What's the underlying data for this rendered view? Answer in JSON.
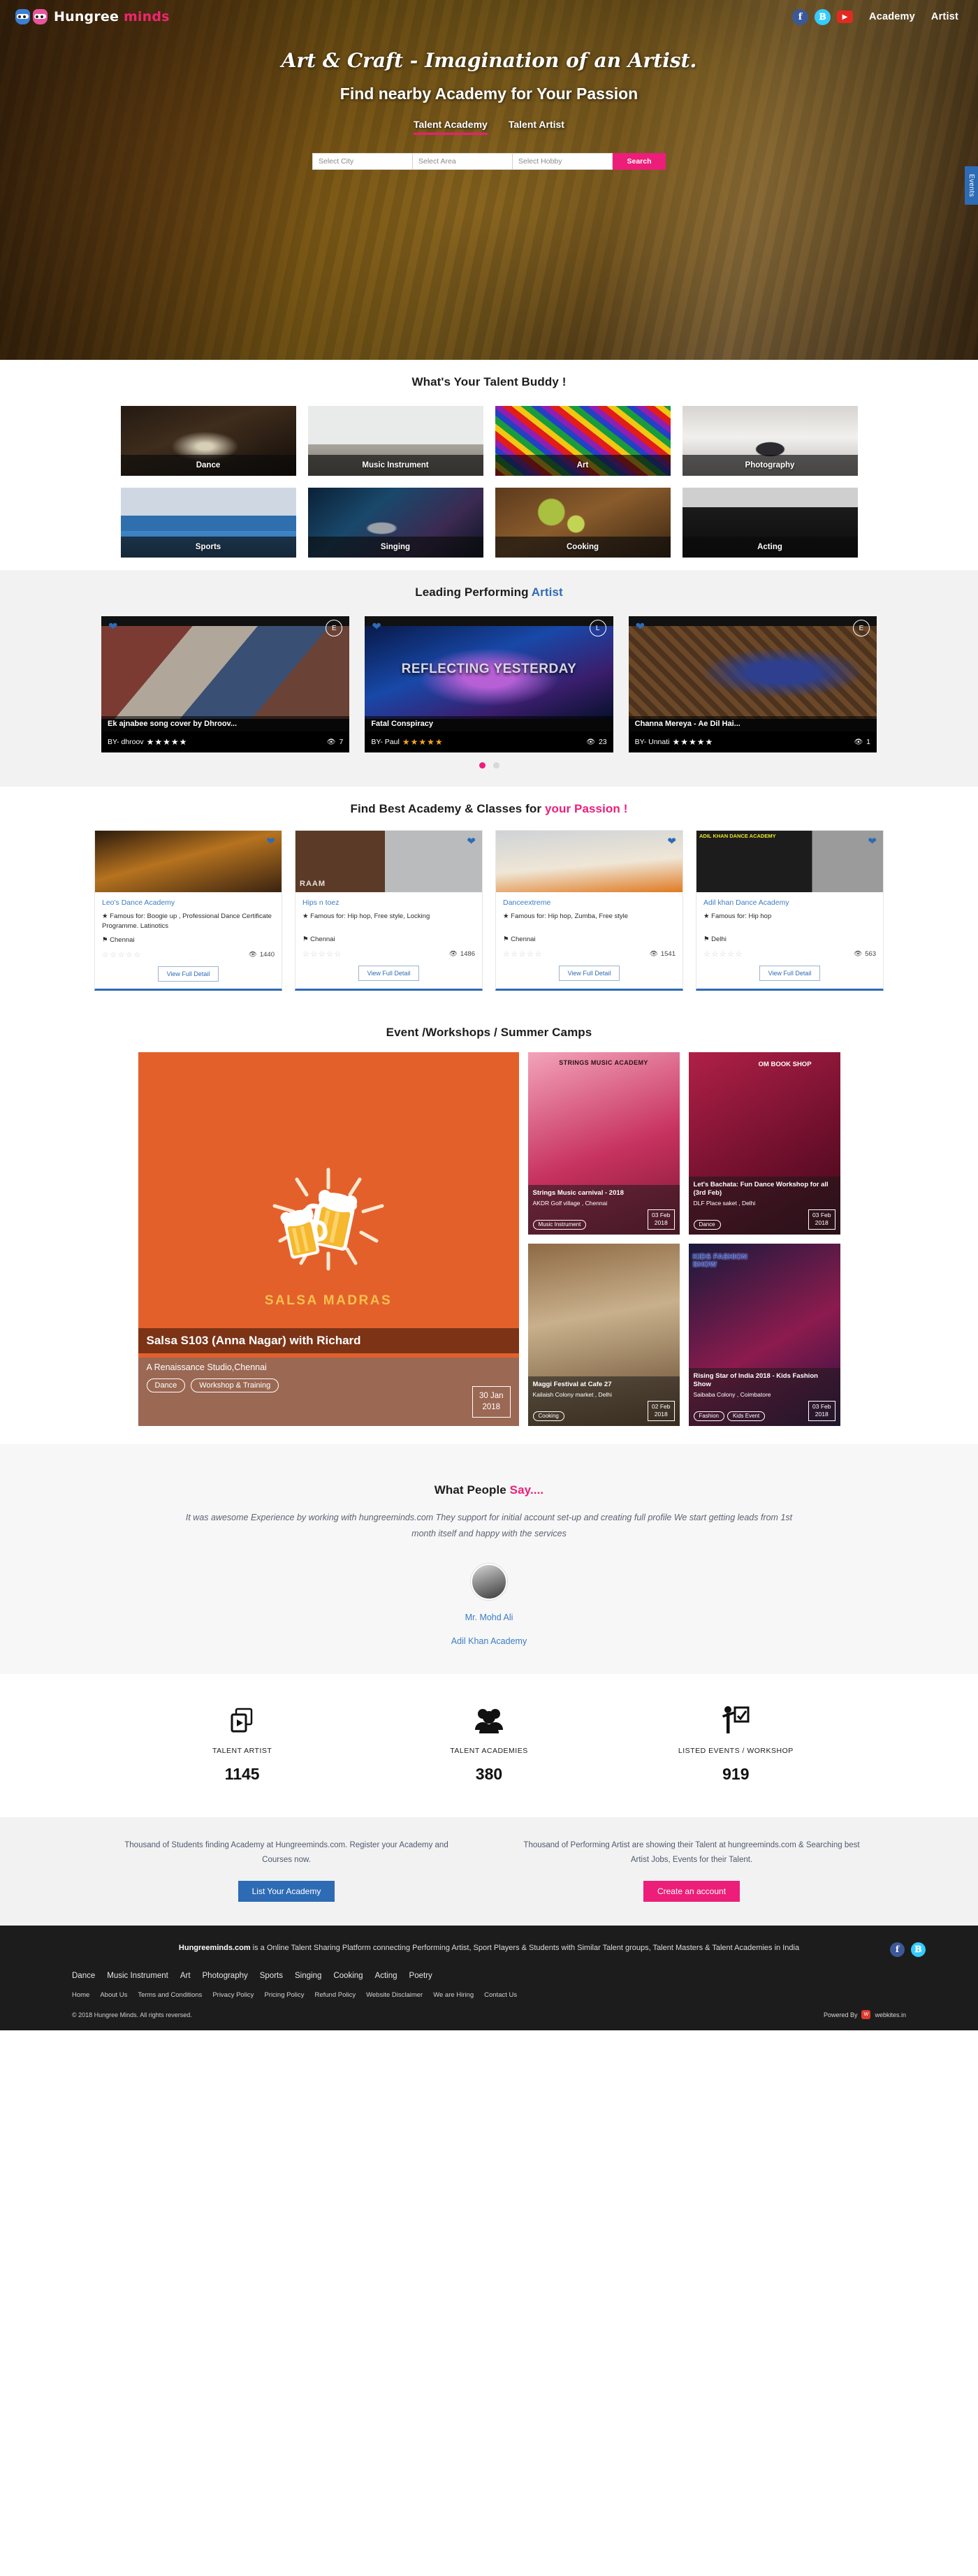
{
  "header": {
    "logo_text_main": "Hungree",
    "logo_text_accent": "minds",
    "social": [
      {
        "name": "facebook-icon",
        "glyph": "f"
      },
      {
        "name": "twitter-icon",
        "glyph": "t"
      },
      {
        "name": "youtube-icon",
        "glyph": "▶"
      }
    ],
    "nav": [
      "Academy",
      "Artist"
    ]
  },
  "hero": {
    "title": "Art & Craft - Imagination of an Artist.",
    "subtitle": "Find nearby Academy for Your Passion",
    "tabs": [
      {
        "label": "Talent Academy",
        "active": true
      },
      {
        "label": "Talent Artist",
        "active": false
      }
    ],
    "search": {
      "city_placeholder": "Select City",
      "area_placeholder": "Select Area",
      "hobby_placeholder": "Select Hobby",
      "button_label": "Search"
    },
    "events_tab_label": "Events"
  },
  "talent": {
    "title": "What's Your Talent Buddy !",
    "items": [
      {
        "label": "Dance",
        "bg": "bg-dance"
      },
      {
        "label": "Music Instrument",
        "bg": "bg-music"
      },
      {
        "label": "Art",
        "bg": "bg-art"
      },
      {
        "label": "Photography",
        "bg": "bg-photo"
      },
      {
        "label": "Sports",
        "bg": "bg-sports"
      },
      {
        "label": "Singing",
        "bg": "bg-singing"
      },
      {
        "label": "Cooking",
        "bg": "bg-cooking"
      },
      {
        "label": "Acting",
        "bg": "bg-acting"
      }
    ]
  },
  "artists": {
    "title_plain": "Leading Performing ",
    "title_accent": "Artist",
    "cards": [
      {
        "title": "Ek ajnabee song cover by Dhroov...",
        "by": "BY- dhroov",
        "badge": "E",
        "stars": "★★★★★",
        "star_color": "white",
        "views": "7"
      },
      {
        "title": "Fatal Conspiracy",
        "by": "BY- Paul",
        "badge": "L",
        "stars": "★★★★★",
        "star_color": "gold",
        "views": "23",
        "overlay_text": "REFLECTING YESTERDAY"
      },
      {
        "title": "Channa Mereya - Ae Dil Hai...",
        "by": "BY- Unnati",
        "badge": "E",
        "stars": "★★★★★",
        "star_color": "white",
        "views": "1"
      }
    ],
    "dots": [
      true,
      false
    ]
  },
  "academies": {
    "title_plain": "Find Best Academy & Classes for ",
    "title_accent": "your Passion !",
    "empty_stars": "☆☆☆☆☆",
    "view_label": "View Full Detail",
    "cards": [
      {
        "name": "Leo's Dance Academy",
        "famous": "★ Famous for: Boogie up , Professional Dance Certificate Programme. Latinotics",
        "location": "⚑ Chennai",
        "views": "1440",
        "thumb": "t1"
      },
      {
        "name": "Hips n toez",
        "famous": "★ Famous for: Hip hop, Free style, Locking",
        "location": "⚑ Chennai",
        "views": "1486",
        "thumb": "t2"
      },
      {
        "name": "Danceextreme",
        "famous": "★ Famous for: Hip hop, Zumba, Free style",
        "location": "⚑ Chennai",
        "views": "1541",
        "thumb": "t3"
      },
      {
        "name": "Adil khan Dance Academy",
        "famous": "★ Famous for: Hip hop",
        "location": "⚑ Delhi",
        "views": "563",
        "thumb": "t4"
      }
    ]
  },
  "events": {
    "title": "Event /Workshops / Summer Camps",
    "featured": {
      "poster_brand": "SALSA MADRAS",
      "title": "Salsa S103 (Anna Nagar) with Richard",
      "place": "A Renaissance Studio,Chennai",
      "tags": [
        "Dance",
        "Workshop & Training"
      ],
      "date_day": "30 Jan",
      "date_year": "2018"
    },
    "small": [
      {
        "title": "Strings Music carnival - 2018",
        "place": "AKDR Golf village ,  Chennai",
        "tags": [
          "Music Instrument"
        ],
        "date_day": "03 Feb",
        "date_year": "2018",
        "bg": "s1"
      },
      {
        "title": "Let's Bachata: Fun Dance Workshop for all (3rd Feb)",
        "place": "DLF Place saket ,  Delhi",
        "tags": [
          "Dance"
        ],
        "date_day": "03 Feb",
        "date_year": "2018",
        "bg": "s2"
      },
      {
        "title": "Maggi Festival at Cafe 27",
        "place": "Kailaish Colony market ,  Delhi",
        "tags": [
          "Cooking"
        ],
        "date_day": "02 Feb",
        "date_year": "2018",
        "bg": "s3"
      },
      {
        "title": "Rising Star of India 2018 - Kids Fashion Show",
        "place": "Saibaba Colony , Coimbatore",
        "tags": [
          "Fashion",
          "Kids Event"
        ],
        "date_day": "03 Feb",
        "date_year": "2018",
        "bg": "s4"
      }
    ]
  },
  "testimonial": {
    "title_plain": "What People ",
    "title_accent": "Say....",
    "quote": "It was awesome Experience by working with hungreeminds.com They support for initial account set-up and creating full profile We start getting leads from 1st month itself and happy with the services",
    "name": "Mr. Mohd Ali",
    "org": "Adil Khan Academy"
  },
  "stats": [
    {
      "icon": "video-player-icon",
      "label": "TALENT ARTIST",
      "value": "1145"
    },
    {
      "icon": "users-group-icon",
      "label": "TALENT ACADEMIES",
      "value": "380"
    },
    {
      "icon": "presenter-board-icon",
      "label": "LISTED EVENTS / WORKSHOP",
      "value": "919"
    }
  ],
  "cta": {
    "left": {
      "text": "Thousand of Students finding Academy at Hungreeminds.com. Register your Academy and Courses now.",
      "button": "List Your Academy"
    },
    "right": {
      "text": "Thousand of Performing Artist are showing their Talent at hungreeminds.com & Searching best Artist Jobs, Events for their Talent.",
      "button": "Create an account"
    }
  },
  "footer": {
    "about_brand": "Hungreeminds.com",
    "about_text": " is a Online Talent Sharing Platform connecting Performing Artist, Sport Players & Students with Similar Talent groups, Talent Masters & Talent Academies in India",
    "categories": [
      "Dance",
      "Music Instrument",
      "Art",
      "Photography",
      "Sports",
      "Singing",
      "Cooking",
      "Acting",
      "Poetry"
    ],
    "links": [
      "Home",
      "About Us",
      "Terms and Conditions",
      "Privacy Policy",
      "Pricing Policy",
      "Refund Policy",
      "Website Disclaimer",
      "We are Hiring",
      "Contact Us"
    ],
    "copyright": "© 2018 Hungree Minds. All rights reversed.",
    "powered_label": "Powered By",
    "powered_name": "webkites.in"
  },
  "colors": {
    "accent_pink": "#ec1e79",
    "accent_blue": "#2e6bb5",
    "link_blue": "#3b7cc4"
  }
}
